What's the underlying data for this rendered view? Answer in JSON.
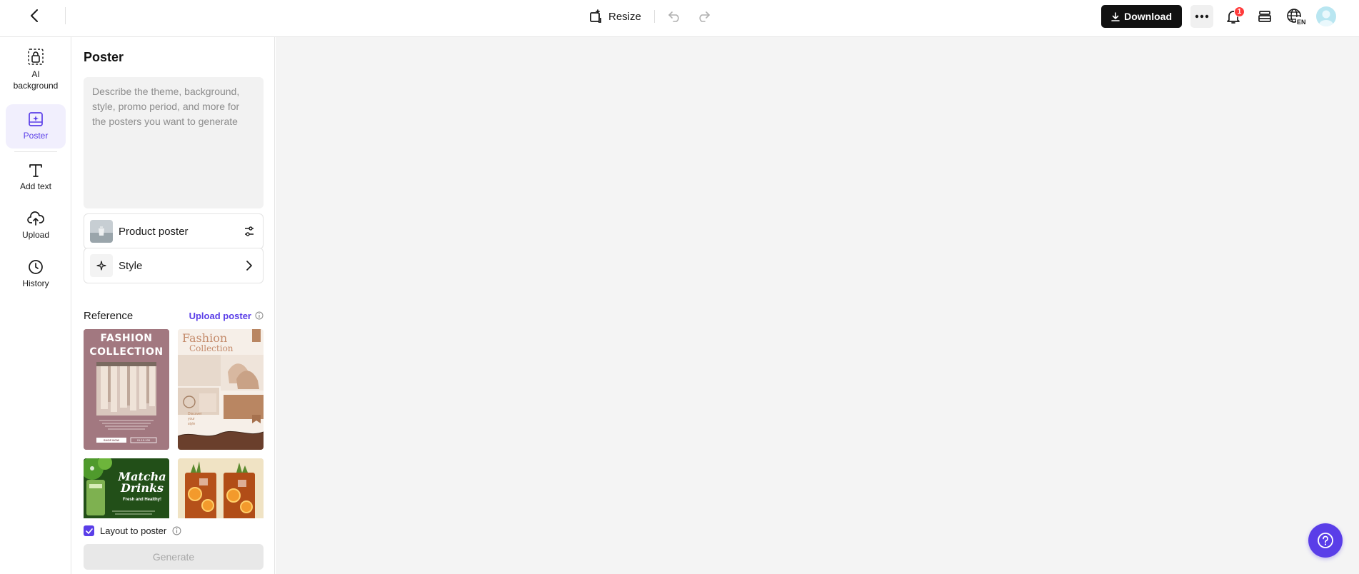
{
  "topbar": {
    "resize_label": "Resize",
    "download_label": "Download",
    "notification_count": "1",
    "language_label": "EN"
  },
  "rail": {
    "items": [
      {
        "label": "AI\nbackground",
        "icon": "ai-background-icon"
      },
      {
        "label": "Poster",
        "icon": "poster-icon",
        "active": true
      },
      {
        "label": "Add text",
        "icon": "text-icon"
      },
      {
        "label": "Upload",
        "icon": "upload-icon"
      },
      {
        "label": "History",
        "icon": "history-icon"
      }
    ]
  },
  "panel": {
    "title": "Poster",
    "prompt_placeholder": "Describe the theme, background, style, promo period, and more for the posters you want to generate",
    "product_poster_label": "Product poster",
    "style_label": "Style",
    "reference_title": "Reference",
    "upload_poster_label": "Upload poster",
    "references": [
      {
        "title_line1": "FASHION",
        "title_line2": "COLLECTION",
        "button": "SHOP NOW",
        "button2": "01-10-100"
      },
      {
        "title_line1": "Fashion",
        "title_line2": "Collection",
        "tagline": "Discover\nyour\nstyle"
      },
      {
        "title_line1": "Matcha",
        "title_line2": "Drinks",
        "tagline": "Fresh and Healthy!"
      },
      {
        "title_line1": "",
        "title_line2": ""
      }
    ],
    "layout_to_poster_label": "Layout to poster",
    "layout_to_poster_checked": true,
    "generate_label": "Generate"
  },
  "colors": {
    "accent": "#5a3ee8",
    "download_bg": "#111111",
    "canvas_bg": "#f4f4f4",
    "badge": "#ff3b3b"
  }
}
